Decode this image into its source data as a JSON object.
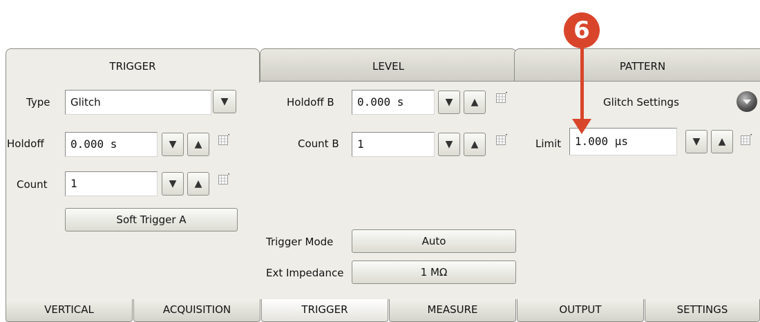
{
  "top_tabs": [
    "TRIGGER",
    "LEVEL",
    "PATTERN"
  ],
  "trigger": {
    "type_label": "Type",
    "type_value": "Glitch",
    "holdoff_label": "Holdoff",
    "holdoff_value": "0.000 s",
    "count_label": "Count",
    "count_value": "1",
    "soft_trigger_label": "Soft Trigger A"
  },
  "level": {
    "holdoff_b_label": "Holdoff B",
    "holdoff_b_value": "0.000 s",
    "count_b_label": "Count B",
    "count_b_value": "1",
    "trigger_mode_label": "Trigger Mode",
    "trigger_mode_value": "Auto",
    "ext_impedance_label": "Ext Impedance",
    "ext_impedance_value": "1 MΩ"
  },
  "pattern": {
    "glitch_settings_label": "Glitch Settings",
    "limit_label": "Limit",
    "limit_value": "1.000 µs"
  },
  "callout": {
    "number": "6",
    "color": "#d9452b"
  },
  "icons": {
    "down": "▼",
    "up": "▲",
    "grid": "keypad-grid-icon",
    "settings": "round-settings-button-icon"
  },
  "bottom_tabs": [
    "VERTICAL",
    "ACQUISITION",
    "TRIGGER",
    "MEASURE",
    "OUTPUT",
    "SETTINGS"
  ]
}
